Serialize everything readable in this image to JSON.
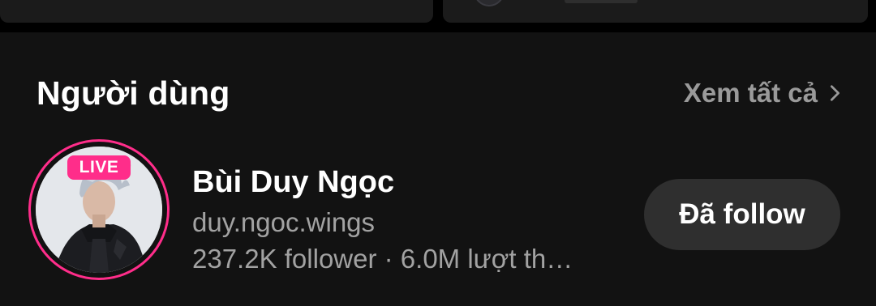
{
  "colors": {
    "page_background": "#000000",
    "section_background": "#121212",
    "live_badge": "#ff2d8a",
    "avatar_ring": "#ff2d8a",
    "secondary_text": "#a2a2a2",
    "follow_button": "#2f2f2f"
  },
  "users_section": {
    "title": "Người dùng",
    "see_all_label": "Xem tất cả",
    "see_all_icon": "chevron-right-icon"
  },
  "user": {
    "live_badge": "LIVE",
    "name": "Bùi Duy Ngọc",
    "handle": "duy.ngoc.wings",
    "stats": "237.2K follower · 6.0M lượt th…",
    "follow_label": "Đã follow"
  }
}
